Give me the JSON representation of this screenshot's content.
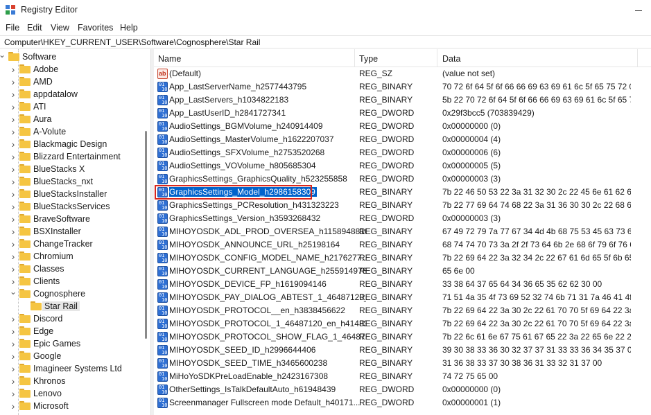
{
  "window": {
    "title": "Registry Editor",
    "icon": "registry-editor-icon"
  },
  "menu": [
    "File",
    "Edit",
    "View",
    "Favorites",
    "Help"
  ],
  "address": "Computer\\HKEY_CURRENT_USER\\Software\\Cognosphere\\Star Rail",
  "tree": {
    "items": [
      {
        "label": "Software",
        "expanded": true
      },
      {
        "label": "Adobe"
      },
      {
        "label": "AMD"
      },
      {
        "label": "appdatalow"
      },
      {
        "label": "ATI"
      },
      {
        "label": "Aura"
      },
      {
        "label": "A-Volute"
      },
      {
        "label": "Blackmagic Design"
      },
      {
        "label": "Blizzard Entertainment"
      },
      {
        "label": "BlueStacks X"
      },
      {
        "label": "BlueStacks_nxt"
      },
      {
        "label": "BlueStacksInstaller"
      },
      {
        "label": "BlueStacksServices"
      },
      {
        "label": "BraveSoftware"
      },
      {
        "label": "BSXInstaller"
      },
      {
        "label": "ChangeTracker"
      },
      {
        "label": "Chromium"
      },
      {
        "label": "Classes"
      },
      {
        "label": "Clients"
      },
      {
        "label": "Cognosphere",
        "expanded": true
      },
      {
        "label": "Star Rail",
        "selected": true
      },
      {
        "label": "Discord"
      },
      {
        "label": "Edge"
      },
      {
        "label": "Epic Games"
      },
      {
        "label": "Google"
      },
      {
        "label": "Imagineer Systems Ltd"
      },
      {
        "label": "Khronos"
      },
      {
        "label": "Lenovo"
      },
      {
        "label": "Microsoft"
      }
    ]
  },
  "list": {
    "columns": [
      "Name",
      "Type",
      "Data"
    ],
    "rows": [
      {
        "name": "(Default)",
        "type": "REG_SZ",
        "data": "(value not set)",
        "icon": "string-value-icon"
      },
      {
        "name": "App_LastServerName_h2577443795",
        "type": "REG_BINARY",
        "data": "70 72 6f 64 5f 6f 66 66 69 63 69 61 6c 5f 65 75 72 00",
        "icon": "binary-value-icon"
      },
      {
        "name": "App_LastServers_h1034822183",
        "type": "REG_BINARY",
        "data": "5b 22 70 72 6f 64 5f 6f 66 66 69 63 69 61 6c 5f 65 75 ...",
        "icon": "binary-value-icon"
      },
      {
        "name": "App_LastUserID_h2841727341",
        "type": "REG_DWORD",
        "data": "0x29f3bcc5 (703839429)",
        "icon": "binary-value-icon"
      },
      {
        "name": "AudioSettings_BGMVolume_h240914409",
        "type": "REG_DWORD",
        "data": "0x00000000 (0)",
        "icon": "binary-value-icon"
      },
      {
        "name": "AudioSettings_MasterVolume_h1622207037",
        "type": "REG_DWORD",
        "data": "0x00000004 (4)",
        "icon": "binary-value-icon"
      },
      {
        "name": "AudioSettings_SFXVolume_h2753520268",
        "type": "REG_DWORD",
        "data": "0x00000006 (6)",
        "icon": "binary-value-icon"
      },
      {
        "name": "AudioSettings_VOVolume_h805685304",
        "type": "REG_DWORD",
        "data": "0x00000005 (5)",
        "icon": "binary-value-icon"
      },
      {
        "name": "GraphicsSettings_GraphicsQuality_h523255858",
        "type": "REG_DWORD",
        "data": "0x00000003 (3)",
        "icon": "binary-value-icon"
      },
      {
        "name": "GraphicsSettings_Model_h2986158309",
        "type": "REG_BINARY",
        "data": "7b 22 46 50 53 22 3a 31 32 30 2c 22 45 6e 61 62 6c 6...",
        "icon": "binary-value-icon",
        "selected": true
      },
      {
        "name": "GraphicsSettings_PCResolution_h431323223",
        "type": "REG_BINARY",
        "data": "7b 22 77 69 64 74 68 22 3a 31 36 30 30 2c 22 68 65 6...",
        "icon": "binary-value-icon"
      },
      {
        "name": "GraphicsSettings_Version_h3593268432",
        "type": "REG_DWORD",
        "data": "0x00000003 (3)",
        "icon": "binary-value-icon"
      },
      {
        "name": "MIHOYOSDK_ADL_PROD_OVERSEA_h1158948810",
        "type": "REG_BINARY",
        "data": "67 49 72 79 7a 77 67 34 4d 4b 68 75 53 45 63 73 6c 6...",
        "icon": "binary-value-icon"
      },
      {
        "name": "MIHOYOSDK_ANNOUNCE_URL_h25198164",
        "type": "REG_BINARY",
        "data": "68 74 74 70 73 3a 2f 2f 73 64 6b 2e 68 6f 79 6f 76 65 ...",
        "icon": "binary-value-icon"
      },
      {
        "name": "MIHOYOSDK_CONFIG_MODEL_NAME_h2176277...",
        "type": "REG_BINARY",
        "data": "7b 22 69 64 22 3a 32 34 2c 22 67 61 6d 65 5f 6b 65 7...",
        "icon": "binary-value-icon"
      },
      {
        "name": "MIHOYOSDK_CURRENT_LANGUAGE_h2559149783",
        "type": "REG_BINARY",
        "data": "65 6e 00",
        "icon": "binary-value-icon"
      },
      {
        "name": "MIHOYOSDK_DEVICE_FP_h1619094146",
        "type": "REG_BINARY",
        "data": "33 38 64 37 65 64 34 36 65 35 62 62 30 00",
        "icon": "binary-value-icon"
      },
      {
        "name": "MIHOYOSDK_PAY_DIALOG_ABTEST_1_46487120_...",
        "type": "REG_BINARY",
        "data": "71 51 4a 35 4f 73 69 52 32 74 6b 71 31 7a 46 41 4f 55 ...",
        "icon": "binary-value-icon"
      },
      {
        "name": "MIHOYOSDK_PROTOCOL__en_h3838456622",
        "type": "REG_BINARY",
        "data": "7b 22 69 64 22 3a 30 2c 22 61 70 70 5f 69 64 22 3a 31...",
        "icon": "binary-value-icon"
      },
      {
        "name": "MIHOYOSDK_PROTOCOL_1_46487120_en_h41483...",
        "type": "REG_BINARY",
        "data": "7b 22 69 64 22 3a 30 2c 22 61 70 70 5f 69 64 22 3a 31...",
        "icon": "binary-value-icon"
      },
      {
        "name": "MIHOYOSDK_PROTOCOL_SHOW_FLAG_1_46487...",
        "type": "REG_BINARY",
        "data": "7b 22 6c 61 6e 67 75 61 67 65 22 3a 22 65 6e 22 2c 2...",
        "icon": "binary-value-icon"
      },
      {
        "name": "MIHOYOSDK_SEED_ID_h2996644406",
        "type": "REG_BINARY",
        "data": "39 30 38 33 36 30 32 37 37 31 33 33 36 34 35 37 00",
        "icon": "binary-value-icon"
      },
      {
        "name": "MIHOYOSDK_SEED_TIME_h3465600238",
        "type": "REG_BINARY",
        "data": "31 36 38 33 37 30 38 36 31 33 32 31 37 00",
        "icon": "binary-value-icon"
      },
      {
        "name": "MiHoYoSDKPreLoadEnable_h2423167308",
        "type": "REG_BINARY",
        "data": "74 72 75 65 00",
        "icon": "binary-value-icon"
      },
      {
        "name": "OtherSettings_IsTalkDefaultAuto_h61948439",
        "type": "REG_DWORD",
        "data": "0x00000000 (0)",
        "icon": "binary-value-icon"
      },
      {
        "name": "Screenmanager Fullscreen mode Default_h40171...",
        "type": "REG_DWORD",
        "data": "0x00000001 (1)",
        "icon": "binary-value-icon"
      }
    ]
  },
  "colors": {
    "selection": "#0063cc",
    "highlight_border": "#d9261c",
    "folder": "#f5c542"
  }
}
